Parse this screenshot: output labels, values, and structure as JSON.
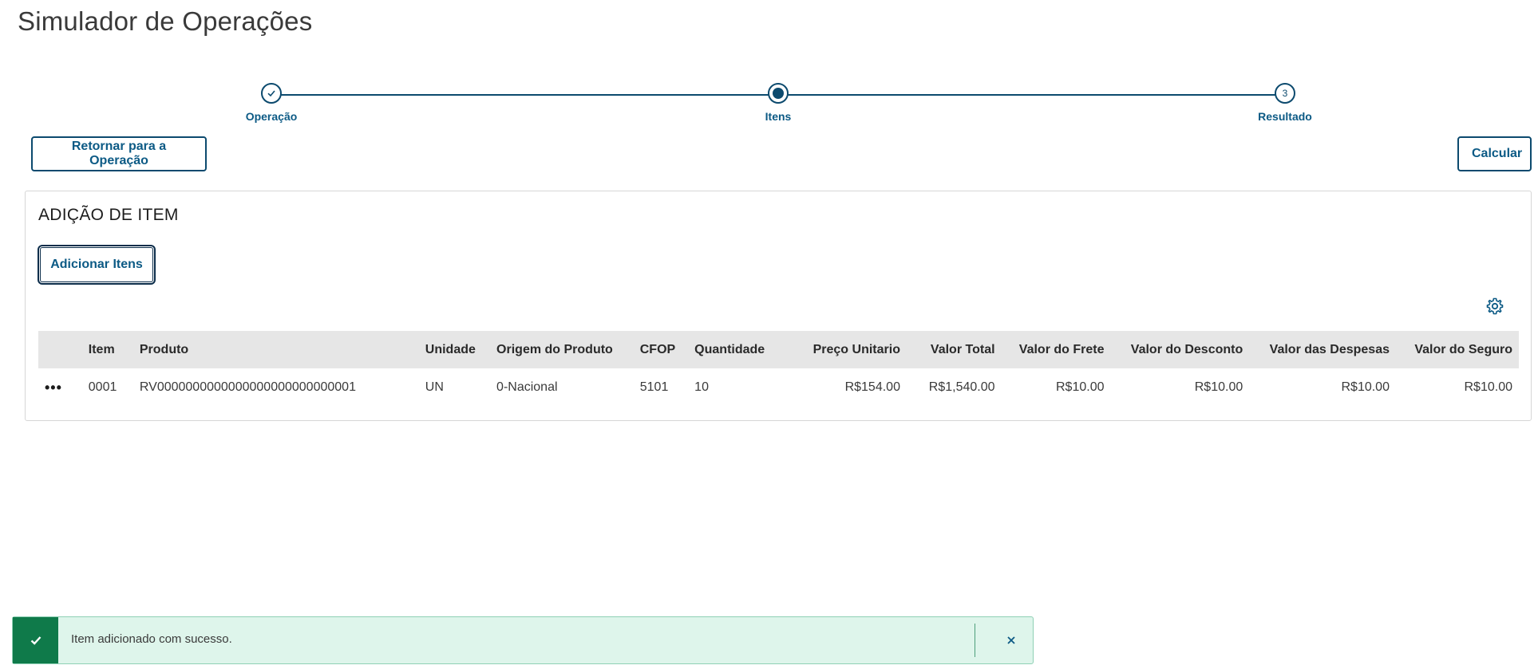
{
  "page": {
    "title": "Simulador de Operações"
  },
  "stepper": {
    "steps": [
      {
        "label": "Operação",
        "state": "done",
        "icon": "check-icon"
      },
      {
        "label": "Itens",
        "state": "active"
      },
      {
        "label": "Resultado",
        "state": "pending",
        "number": "3"
      }
    ]
  },
  "actions": {
    "back_label": "Retornar para a Operação",
    "calc_label": "Calcular"
  },
  "panel": {
    "title": "ADIÇÃO DE ITEM",
    "add_label": "Adicionar Itens",
    "settings_icon": "gear-icon"
  },
  "table": {
    "columns": [
      "",
      "Item",
      "Produto",
      "Unidade",
      "Origem do Produto",
      "CFOP",
      "Quantidade",
      "Preço Unitario",
      "Valor Total",
      "Valor do Frete",
      "Valor do Desconto",
      "Valor das Despesas",
      "Valor do Seguro"
    ],
    "rows": [
      {
        "more": "•••",
        "item": "0001",
        "produto": "RV0000000000000000000000000001",
        "unidade": "UN",
        "origem": "0-Nacional",
        "cfop": "5101",
        "quantidade": "10",
        "preco": "R$154.00",
        "total": "R$1,540.00",
        "frete": "R$10.00",
        "desconto": "R$10.00",
        "despesas": "R$10.00",
        "seguro": "R$10.00"
      }
    ]
  },
  "toast": {
    "message": "Item adicionado com sucesso.",
    "type": "success",
    "color": "#0f7a4a"
  },
  "colors": {
    "primary": "#0c4a6e",
    "success": "#0f7a4a",
    "success_bg": "#def5eb"
  }
}
